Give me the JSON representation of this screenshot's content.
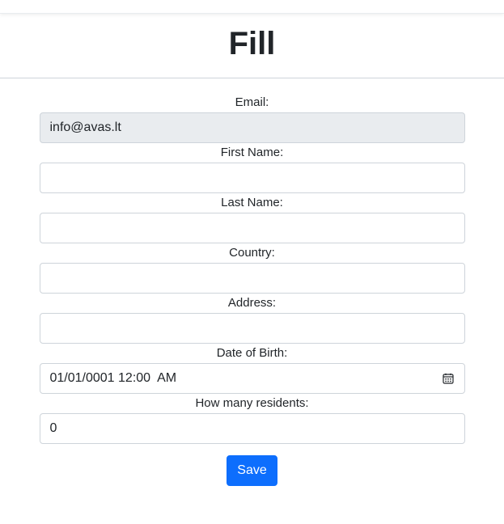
{
  "header": {
    "title": "Fill"
  },
  "form": {
    "email": {
      "label": "Email:",
      "value": "info@avas.lt",
      "readonly": true
    },
    "first_name": {
      "label": "First Name:",
      "value": ""
    },
    "last_name": {
      "label": "Last Name:",
      "value": ""
    },
    "country": {
      "label": "Country:",
      "value": ""
    },
    "address": {
      "label": "Address:",
      "value": ""
    },
    "date_of_birth": {
      "label": "Date of Birth:",
      "value": "01/01/0001 12:00  AM",
      "icon": "calendar-icon"
    },
    "residents": {
      "label": "How many residents:",
      "value": "0"
    },
    "save_label": "Save"
  },
  "colors": {
    "primary": "#0d6efd",
    "readonly_bg": "#e9ecef",
    "border": "#ced4da"
  }
}
